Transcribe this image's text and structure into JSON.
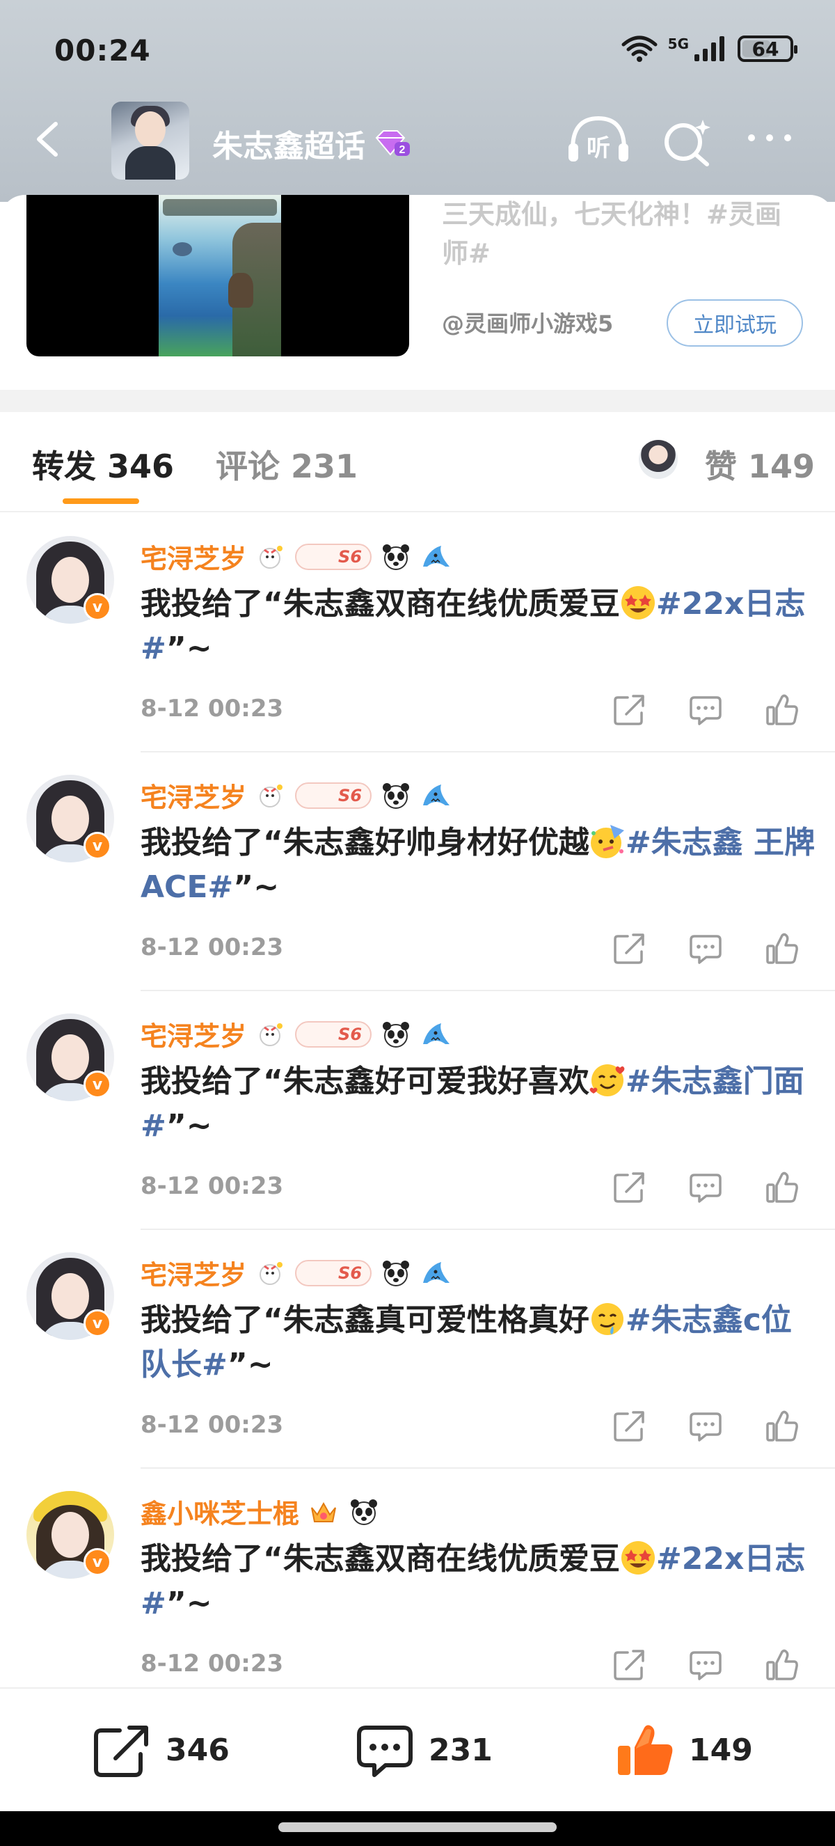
{
  "status_bar": {
    "time": "00:24",
    "network": "5G",
    "battery": "64",
    "battery_level": 0.64
  },
  "header": {
    "topic_title": "朱志鑫超话",
    "back_icon": "chevron-left-icon",
    "listen_label": "听",
    "icons": [
      "headphones-listen-icon",
      "sparkle-search-icon",
      "more-dots-icon"
    ],
    "vip_level": "2"
  },
  "ad": {
    "text": "三天成仙，七天化神！#灵画师#",
    "source": "@灵画师小游戏5",
    "try_button": "立即试玩"
  },
  "tabs": {
    "repost": "转发 346",
    "comment": "评论 231",
    "like": "赞 149",
    "active": "repost",
    "accent_color": "#ff9a19"
  },
  "items": [
    {
      "username": "宅浔芝岁",
      "badge": "S6",
      "text_before": "我投给了“朱志鑫双商在线优质爱豆",
      "emoji": "star-struck",
      "tag": "#22x日志#",
      "text_after": "”~",
      "time": "8-12 00:23"
    },
    {
      "username": "宅浔芝岁",
      "badge": "S6",
      "text_before": "我投给了“朱志鑫好帅身材好优越",
      "emoji": "party-face",
      "tag": "#朱志鑫 王牌ACE#",
      "text_after": "”~",
      "time": "8-12 00:23"
    },
    {
      "username": "宅浔芝岁",
      "badge": "S6",
      "text_before": "我投给了“朱志鑫好可爱我好喜欢",
      "emoji": "smiling-hearts",
      "tag": "#朱志鑫门面#",
      "text_after": "”~",
      "time": "8-12 00:23"
    },
    {
      "username": "宅浔芝岁",
      "badge": "S6",
      "text_before": "我投给了“朱志鑫真可爱性格真好",
      "emoji": "drooling-face",
      "tag": "#朱志鑫c位队长#",
      "text_after": "”~",
      "time": "8-12 00:23"
    },
    {
      "username": "鑫小咪芝士棍",
      "badge": "",
      "text_before": "我投给了“朱志鑫双商在线优质爱豆",
      "emoji": "star-struck",
      "tag": "#22x日志#",
      "text_after": "”~",
      "time": "8-12 00:23"
    }
  ],
  "bottom_bar": {
    "repost_count": "346",
    "comment_count": "231",
    "like_count": "149"
  }
}
